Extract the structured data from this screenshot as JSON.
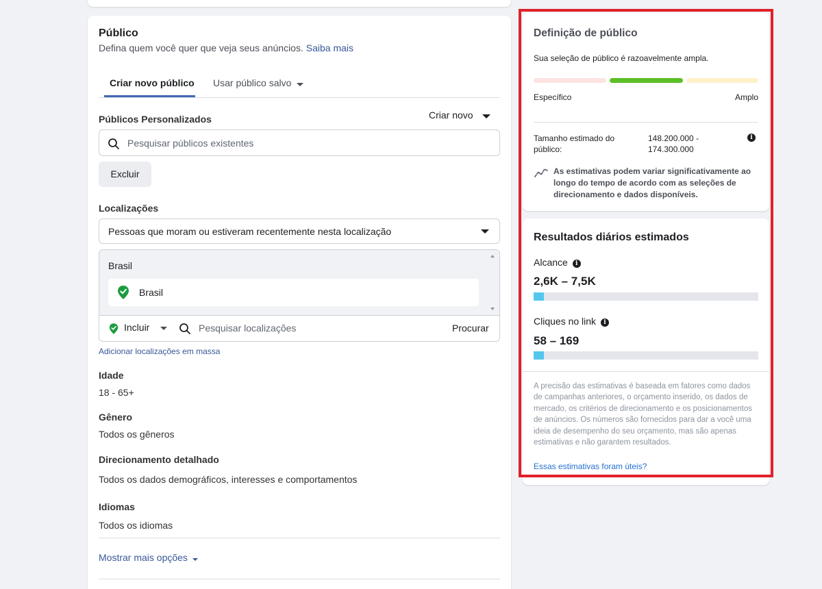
{
  "audience": {
    "title": "Público",
    "subtitle": "Defina quem você quer que veja seus anúncios.",
    "learn_more": "Saiba mais",
    "tabs": [
      {
        "label": "Criar novo público",
        "active": true
      },
      {
        "label": "Usar público salvo",
        "active": false
      }
    ],
    "custom_audiences": {
      "label": "Públicos Personalizados",
      "create_new": "Criar novo",
      "search_placeholder": "Pesquisar públicos existentes",
      "exclude_button": "Excluir"
    },
    "locations": {
      "label": "Localizações",
      "dropdown_value": "Pessoas que moram ou estiveram recentemente nesta localização",
      "group_title": "Brasil",
      "chip_label": "Brasil",
      "include_label": "Incluir",
      "search_placeholder": "Pesquisar localizações",
      "browse_button": "Procurar",
      "bulk_link": "Adicionar localizações em massa"
    },
    "age": {
      "label": "Idade",
      "value": "18 - 65+"
    },
    "gender": {
      "label": "Gênero",
      "value": "Todos os gêneros"
    },
    "detailed_targeting": {
      "label": "Direcionamento detalhado",
      "value": "Todos os dados demográficos, interesses e comportamentos"
    },
    "languages": {
      "label": "Idiomas",
      "value": "Todos os idiomas"
    },
    "more_options": "Mostrar mais opções"
  },
  "definition": {
    "title": "Definição de público",
    "description": "Sua seleção de público é razoavelmente ampla.",
    "left_label": "Específico",
    "right_label": "Amplo",
    "size_label": "Tamanho estimado do público:",
    "size_value": "148.200.000 - 174.300.000",
    "note": "As estimativas podem variar significativamente ao longo do tempo de acordo com as seleções de direcionamento e dados disponíveis.",
    "colors": {
      "specific": "#fde3e1",
      "active": "#5cbf26",
      "broad": "#fff1c7"
    }
  },
  "daily_results": {
    "title": "Resultados diários estimados",
    "reach": {
      "label": "Alcance",
      "value": "2,6K – 7,5K",
      "fill_fraction": 0.045
    },
    "link_clicks": {
      "label": "Cliques no link",
      "value": "58 – 169",
      "fill_fraction": 0.045
    },
    "disclaimer": "A precisão das estimativas é baseada em fatores como dados de campanhas anteriores, o orçamento inserido, os dados de mercado, os critérios de direcionamento e os posicionamentos de anúncios. Os números são fornecidos para dar a você uma ideia de desempenho do seu orçamento, mas são apenas estimativas e não garantem resultados.",
    "feedback_link": "Essas estimativas foram úteis?"
  }
}
